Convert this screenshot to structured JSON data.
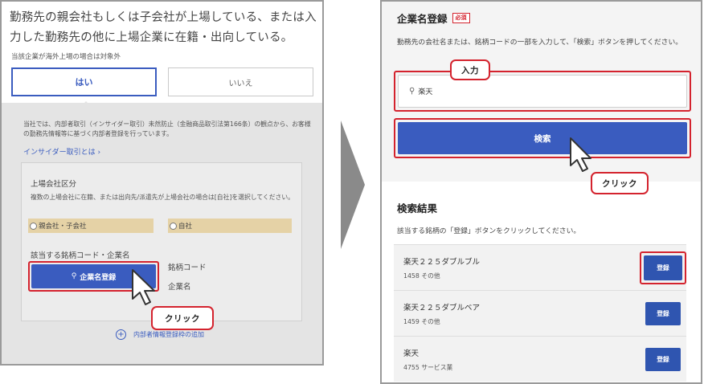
{
  "left": {
    "question": "勤務先の親会社もしくは子会社が上場している、または入力した勤務先の他に上場企業に在籍・出向している。",
    "note": "当該企業が海外上場の場合は対象外",
    "yes_label": "はい",
    "no_label": "いいえ",
    "info": "当社では、内部者取引（インサイダー取引）未然防止（金融商品取引法第166条）の観点から、お客様の勤務先情報等に基づく内部者登録を行っています。",
    "insider_link": "インサイダー取引とは ›",
    "listed_section_title": "上場会社区分",
    "listed_section_desc": "複数の上場会社に在籍、または出向先/派遣先が上場会社の場合は[自社]を選択してください。",
    "radio_options": [
      "親会社・子会社",
      "自社"
    ],
    "code_section_title": "該当する銘柄コード・企業名",
    "register_button": "企業名登録",
    "side_labels": [
      "銘柄コード",
      "企業名"
    ],
    "add_info_link": "内部者情報登録枠の追加",
    "click_callout": "クリック"
  },
  "right": {
    "title": "企業名登録",
    "required_badge": "必須",
    "description": "勤務先の会社名または、銘柄コードの一部を入力して、「検索」ボタンを押してください。",
    "input_callout": "入力",
    "search_value": "楽天",
    "search_button": "検索",
    "click_callout": "クリック",
    "results_title": "検索結果",
    "results_desc": "該当する銘柄の「登録」ボタンをクリックしてください。",
    "results": [
      {
        "name": "楽天２２５ダブルブル",
        "code": "1458 その他",
        "button": "登録"
      },
      {
        "name": "楽天２２５ダブルベア",
        "code": "1459 その他",
        "button": "登録"
      },
      {
        "name": "楽天",
        "code": "4755 サービス業",
        "button": "登録"
      }
    ]
  },
  "colors": {
    "accent_blue": "#3a5cbf",
    "highlight_red": "#d4232e",
    "radio_beige": "#e5d2a6",
    "arrow_gray": "#8a8a8a"
  },
  "icons": [
    "search-icon",
    "plus-circle-icon",
    "mouse-cursor-icon",
    "chevron-right-icon"
  ]
}
